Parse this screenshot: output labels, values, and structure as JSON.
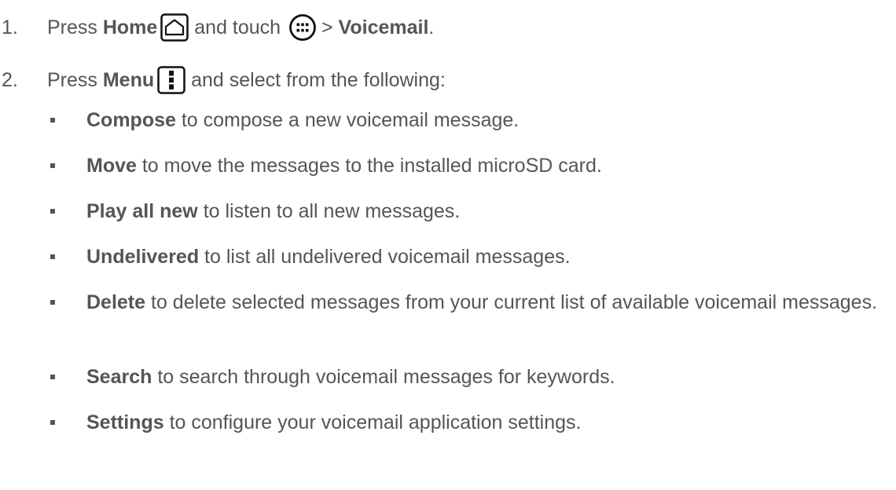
{
  "steps": [
    {
      "number": "1.",
      "pre": "Press ",
      "bold1": "Home",
      "icon1": "home-icon",
      "mid": " and touch ",
      "icon2": "apps-icon",
      "sep": " > ",
      "bold2": "Voicemail",
      "post": "."
    },
    {
      "number": "2.",
      "pre": "Press ",
      "bold1": "Menu",
      "icon1": "menu-icon",
      "post": " and select from the following:"
    }
  ],
  "options": [
    {
      "label": "Compose",
      "desc": " to compose a new voicemail message."
    },
    {
      "label": "Move",
      "desc": " to move the messages to the installed microSD card."
    },
    {
      "label": "Play all new",
      "desc": " to listen to all new messages."
    },
    {
      "label": "Undelivered",
      "desc": " to list all undelivered voicemail messages."
    },
    {
      "label": "Delete",
      "desc": " to delete selected messages from your current list of available voicemail messages."
    },
    {
      "label": "Search",
      "desc": " to search through voicemail messages for keywords."
    },
    {
      "label": "Settings",
      "desc": " to configure your voicemail application settings."
    }
  ]
}
